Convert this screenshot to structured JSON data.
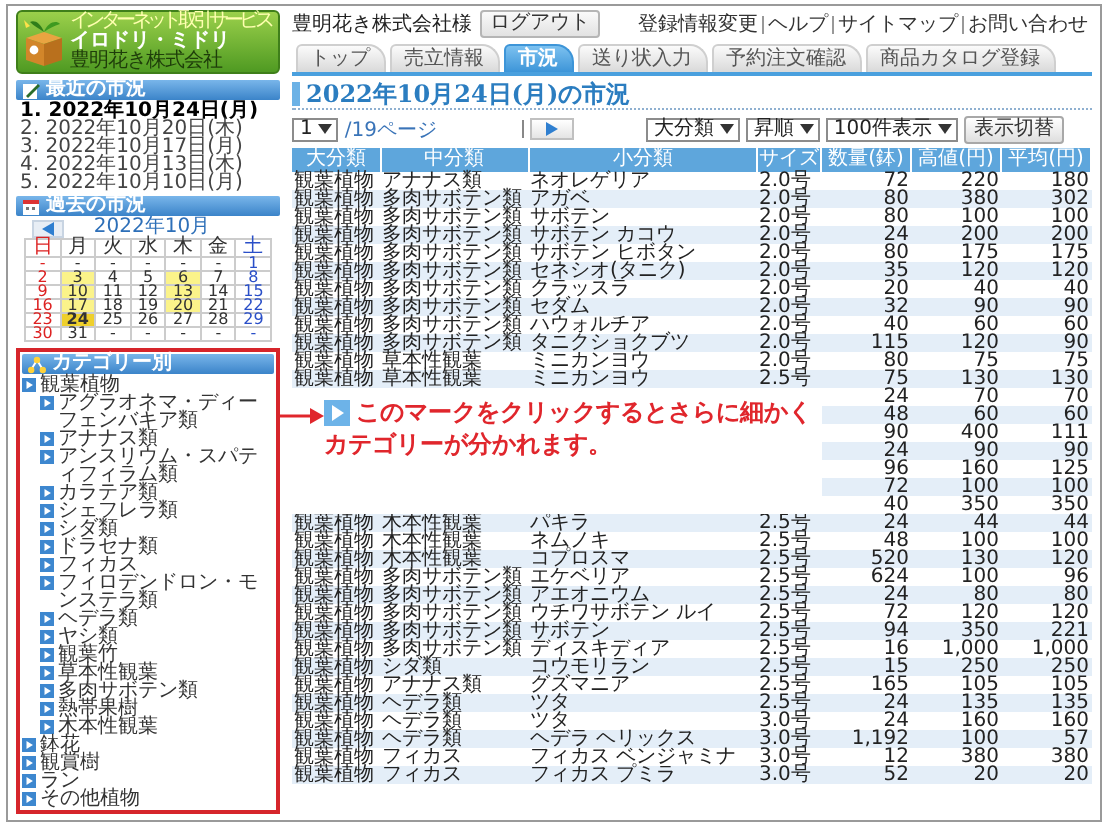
{
  "logo": {
    "tagline": "インターネット取引サービス",
    "name": "イロドリ・ミドリ",
    "company": "豊明花き株式会社"
  },
  "header": {
    "customer": "豊明花き株式会社様",
    "logout": "ログアウト",
    "links": [
      "登録情報変更",
      "ヘルプ",
      "サイトマップ",
      "お問い合わせ"
    ]
  },
  "tabs": [
    {
      "label": "トップ",
      "selected": false
    },
    {
      "label": "売立情報",
      "selected": false
    },
    {
      "label": "市況",
      "selected": true
    },
    {
      "label": "送り状入力",
      "selected": false
    },
    {
      "label": "予約注文確認",
      "selected": false
    },
    {
      "label": "商品カタログ登録",
      "selected": false
    }
  ],
  "recent": {
    "title": "最近の市況",
    "items": [
      {
        "label": "1. 2022年10月24日(月)",
        "selected": true
      },
      {
        "label": "2. 2022年10月20日(木)",
        "selected": false
      },
      {
        "label": "3. 2022年10月17日(月)",
        "selected": false
      },
      {
        "label": "4. 2022年10月13日(木)",
        "selected": false
      },
      {
        "label": "5. 2022年10月10日(月)",
        "selected": false
      }
    ]
  },
  "past": {
    "title": "過去の市況",
    "month": "2022年10月",
    "weekdays": [
      "日",
      "月",
      "火",
      "水",
      "木",
      "金",
      "土"
    ],
    "weeks": [
      [
        {
          "label": "-",
          "highlighted": false,
          "selected": false
        },
        {
          "label": "-",
          "highlighted": false,
          "selected": false
        },
        {
          "label": "-",
          "highlighted": false,
          "selected": false
        },
        {
          "label": "-",
          "highlighted": false,
          "selected": false
        },
        {
          "label": "-",
          "highlighted": false,
          "selected": false
        },
        {
          "label": "-",
          "highlighted": false,
          "selected": false
        },
        {
          "label": "1",
          "highlighted": false,
          "selected": false
        }
      ],
      [
        {
          "label": "2",
          "highlighted": false,
          "selected": false
        },
        {
          "label": "3",
          "highlighted": true,
          "selected": false
        },
        {
          "label": "4",
          "highlighted": false,
          "selected": false
        },
        {
          "label": "5",
          "highlighted": false,
          "selected": false
        },
        {
          "label": "6",
          "highlighted": true,
          "selected": false
        },
        {
          "label": "7",
          "highlighted": false,
          "selected": false
        },
        {
          "label": "8",
          "highlighted": false,
          "selected": false
        }
      ],
      [
        {
          "label": "9",
          "highlighted": false,
          "selected": false
        },
        {
          "label": "10",
          "highlighted": true,
          "selected": false
        },
        {
          "label": "11",
          "highlighted": false,
          "selected": false
        },
        {
          "label": "12",
          "highlighted": false,
          "selected": false
        },
        {
          "label": "13",
          "highlighted": true,
          "selected": false
        },
        {
          "label": "14",
          "highlighted": false,
          "selected": false
        },
        {
          "label": "15",
          "highlighted": false,
          "selected": false
        }
      ],
      [
        {
          "label": "16",
          "highlighted": false,
          "selected": false
        },
        {
          "label": "17",
          "highlighted": true,
          "selected": false
        },
        {
          "label": "18",
          "highlighted": false,
          "selected": false
        },
        {
          "label": "19",
          "highlighted": false,
          "selected": false
        },
        {
          "label": "20",
          "highlighted": true,
          "selected": false
        },
        {
          "label": "21",
          "highlighted": false,
          "selected": false
        },
        {
          "label": "22",
          "highlighted": false,
          "selected": false
        }
      ],
      [
        {
          "label": "23",
          "highlighted": false,
          "selected": false
        },
        {
          "label": "24",
          "highlighted": true,
          "selected": true
        },
        {
          "label": "25",
          "highlighted": false,
          "selected": false
        },
        {
          "label": "26",
          "highlighted": false,
          "selected": false
        },
        {
          "label": "27",
          "highlighted": false,
          "selected": false
        },
        {
          "label": "28",
          "highlighted": false,
          "selected": false
        },
        {
          "label": "29",
          "highlighted": false,
          "selected": false
        }
      ],
      [
        {
          "label": "30",
          "highlighted": false,
          "selected": false
        },
        {
          "label": "31",
          "highlighted": false,
          "selected": false
        },
        {
          "label": "-",
          "highlighted": false,
          "selected": false
        },
        {
          "label": "-",
          "highlighted": false,
          "selected": false
        },
        {
          "label": "-",
          "highlighted": false,
          "selected": false
        },
        {
          "label": "-",
          "highlighted": false,
          "selected": false
        },
        {
          "label": "-",
          "highlighted": false,
          "selected": false
        }
      ]
    ]
  },
  "categories": {
    "title": "カテゴリー別",
    "items": [
      {
        "label": "観葉植物",
        "children": [
          {
            "label": "アグラオネマ・ディーフェンバキア類"
          },
          {
            "label": "アナナス類"
          },
          {
            "label": "アンスリウム・スパティフィラム類"
          },
          {
            "label": "カラテア類"
          },
          {
            "label": "シェフレラ類"
          },
          {
            "label": "シダ類"
          },
          {
            "label": "ドラセナ類"
          },
          {
            "label": "フィカス"
          },
          {
            "label": "フィロデンドロン・モンステラ類"
          },
          {
            "label": "ヘデラ類"
          },
          {
            "label": "ヤシ類"
          },
          {
            "label": "観葉竹"
          },
          {
            "label": "草本性観葉"
          },
          {
            "label": "多肉サボテン類"
          },
          {
            "label": "熱帯果樹"
          },
          {
            "label": "木本性観葉"
          }
        ]
      },
      {
        "label": "鉢花"
      },
      {
        "label": "観賞樹"
      },
      {
        "label": "ラン"
      },
      {
        "label": "その他植物"
      }
    ]
  },
  "title": "2022年10月24日(月)の市況",
  "pager": {
    "page": "1",
    "total": "/19ページ"
  },
  "sort": {
    "group": "大分類",
    "order": "昇順",
    "per_page": "100件表示",
    "apply": "表示切替"
  },
  "table": {
    "columns": [
      "大分類",
      "中分類",
      "小分類",
      "サイズ",
      "数量(鉢)",
      "高値(円)",
      "平均(円)"
    ],
    "rows": [
      {
        "category": "観葉植物",
        "subcategory": "アナナス類",
        "item": "ネオレゲリア",
        "size": "2.0号",
        "quantity": "72",
        "high": "220",
        "average": "180"
      },
      {
        "category": "観葉植物",
        "subcategory": "多肉サボテン類",
        "item": "アガベ",
        "size": "2.0号",
        "quantity": "80",
        "high": "380",
        "average": "302"
      },
      {
        "category": "観葉植物",
        "subcategory": "多肉サボテン類",
        "item": "サボテン",
        "size": "2.0号",
        "quantity": "80",
        "high": "100",
        "average": "100"
      },
      {
        "category": "観葉植物",
        "subcategory": "多肉サボテン類",
        "item": "サボテン カコウ",
        "size": "2.0号",
        "quantity": "24",
        "high": "200",
        "average": "200"
      },
      {
        "category": "観葉植物",
        "subcategory": "多肉サボテン類",
        "item": "サボテン ヒボタン",
        "size": "2.0号",
        "quantity": "80",
        "high": "175",
        "average": "175"
      },
      {
        "category": "観葉植物",
        "subcategory": "多肉サボテン類",
        "item": "セネシオ(タニク)",
        "size": "2.0号",
        "quantity": "35",
        "high": "120",
        "average": "120"
      },
      {
        "category": "観葉植物",
        "subcategory": "多肉サボテン類",
        "item": "クラッスラ",
        "size": "2.0号",
        "quantity": "20",
        "high": "40",
        "average": "40"
      },
      {
        "category": "観葉植物",
        "subcategory": "多肉サボテン類",
        "item": "セダム",
        "size": "2.0号",
        "quantity": "32",
        "high": "90",
        "average": "90"
      },
      {
        "category": "観葉植物",
        "subcategory": "多肉サボテン類",
        "item": "ハウォルチア",
        "size": "2.0号",
        "quantity": "40",
        "high": "60",
        "average": "60"
      },
      {
        "category": "観葉植物",
        "subcategory": "多肉サボテン類",
        "item": "タニクショクブツ",
        "size": "2.0号",
        "quantity": "115",
        "high": "120",
        "average": "90"
      },
      {
        "category": "観葉植物",
        "subcategory": "草本性観葉",
        "item": "ミニカンヨウ",
        "size": "2.0号",
        "quantity": "80",
        "high": "75",
        "average": "75"
      },
      {
        "category": "観葉植物",
        "subcategory": "草本性観葉",
        "item": "ミニカンヨウ",
        "size": "2.5号",
        "quantity": "75",
        "high": "130",
        "average": "130"
      },
      {
        "quantity": "24",
        "high": "70",
        "average": "70"
      },
      {
        "quantity": "48",
        "high": "60",
        "average": "60"
      },
      {
        "quantity": "90",
        "high": "400",
        "average": "111"
      },
      {
        "quantity": "24",
        "high": "90",
        "average": "90"
      },
      {
        "quantity": "96",
        "high": "160",
        "average": "125"
      },
      {
        "quantity": "72",
        "high": "100",
        "average": "100"
      },
      {
        "quantity": "40",
        "high": "350",
        "average": "350"
      },
      {
        "category": "観葉植物",
        "subcategory": "木本性観葉",
        "item": "パキラ",
        "size": "2.5号",
        "quantity": "24",
        "high": "44",
        "average": "44"
      },
      {
        "category": "観葉植物",
        "subcategory": "木本性観葉",
        "item": "ネムノキ",
        "size": "2.5号",
        "quantity": "48",
        "high": "100",
        "average": "100"
      },
      {
        "category": "観葉植物",
        "subcategory": "木本性観葉",
        "item": "コプロスマ",
        "size": "2.5号",
        "quantity": "520",
        "high": "130",
        "average": "120"
      },
      {
        "category": "観葉植物",
        "subcategory": "多肉サボテン類",
        "item": "エケベリア",
        "size": "2.5号",
        "quantity": "624",
        "high": "100",
        "average": "96"
      },
      {
        "category": "観葉植物",
        "subcategory": "多肉サボテン類",
        "item": "アエオニウム",
        "size": "2.5号",
        "quantity": "24",
        "high": "80",
        "average": "80"
      },
      {
        "category": "観葉植物",
        "subcategory": "多肉サボテン類",
        "item": "ウチワサボテン ルイ",
        "size": "2.5号",
        "quantity": "72",
        "high": "120",
        "average": "120"
      },
      {
        "category": "観葉植物",
        "subcategory": "多肉サボテン類",
        "item": "サボテン",
        "size": "2.5号",
        "quantity": "94",
        "high": "350",
        "average": "221"
      },
      {
        "category": "観葉植物",
        "subcategory": "多肉サボテン類",
        "item": "ディスキディア",
        "size": "2.5号",
        "quantity": "16",
        "high": "1,000",
        "average": "1,000"
      },
      {
        "category": "観葉植物",
        "subcategory": "シダ類",
        "item": "コウモリラン",
        "size": "2.5号",
        "quantity": "15",
        "high": "250",
        "average": "250"
      },
      {
        "category": "観葉植物",
        "subcategory": "アナナス類",
        "item": "グズマニア",
        "size": "2.5号",
        "quantity": "165",
        "high": "105",
        "average": "105"
      },
      {
        "category": "観葉植物",
        "subcategory": "ヘデラ類",
        "item": "ツタ",
        "size": "2.5号",
        "quantity": "24",
        "high": "135",
        "average": "135"
      },
      {
        "category": "観葉植物",
        "subcategory": "ヘデラ類",
        "item": "ツタ",
        "size": "3.0号",
        "quantity": "24",
        "high": "160",
        "average": "160"
      },
      {
        "category": "観葉植物",
        "subcategory": "ヘデラ類",
        "item": "ヘデラ ヘリックス",
        "size": "3.0号",
        "quantity": "1,192",
        "high": "100",
        "average": "57"
      },
      {
        "category": "観葉植物",
        "subcategory": "フィカス",
        "item": "フィカス ベンジャミナ",
        "size": "3.0号",
        "quantity": "12",
        "high": "380",
        "average": "380"
      },
      {
        "category": "観葉植物",
        "subcategory": "フィカス",
        "item": "フィカス プミラ",
        "size": "3.0号",
        "quantity": "52",
        "high": "20",
        "average": "20"
      }
    ]
  },
  "note": {
    "lines": [
      "このマークをクリックするとさらに細かく",
      "カテゴリーが分かれます。"
    ]
  }
}
